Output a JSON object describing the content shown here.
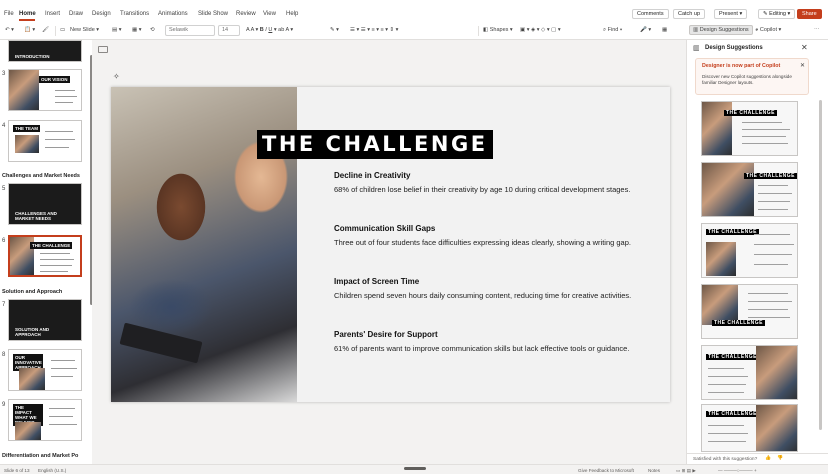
{
  "menubar": {
    "tabs": [
      "File",
      "Home",
      "Insert",
      "Draw",
      "Design",
      "Transitions",
      "Animations",
      "Slide Show",
      "Review",
      "View",
      "Help"
    ],
    "active_tab": "Home",
    "comments": "Comments",
    "catch_up": "Catch up",
    "present": "Present",
    "editing": "Editing",
    "share": "Share"
  },
  "ribbon": {
    "new_slide": "New Slide",
    "font_name": "Selawik",
    "font_size": "14",
    "shapes": "Shapes",
    "find": "Find",
    "design_suggestions": "Design Suggestions",
    "copilot": "Copilot"
  },
  "thumbnails": {
    "sections": [
      "Challenges and Market Needs",
      "Solution and Approach",
      "Differentiation and Market Po"
    ],
    "slides": [
      {
        "num": "",
        "label": "INTRODUCTION"
      },
      {
        "num": "3",
        "label": "OUR VISION"
      },
      {
        "num": "4",
        "label": "THE TEAM"
      },
      {
        "num": "5",
        "label": "CHALLENGES AND MARKET NEEDS"
      },
      {
        "num": "6",
        "label": "THE CHALLENGE"
      },
      {
        "num": "7",
        "label": "SOLUTION AND APPROACH"
      },
      {
        "num": "8",
        "label": "OUR INNOVATIVE APPROACH"
      },
      {
        "num": "9",
        "label": "THE IMPACT WHAT WE DELIVER"
      }
    ]
  },
  "slide": {
    "title": "THE CHALLENGE",
    "items": [
      {
        "heading": "Decline in Creativity",
        "body": "68% of children lose belief in their creativity by age 10 during critical development stages."
      },
      {
        "heading": "Communication Skill Gaps",
        "body": "Three out of four students face difficulties expressing ideas clearly, showing a writing gap."
      },
      {
        "heading": "Impact of Screen Time",
        "body": "Children spend seven hours daily consuming content, reducing time for creative activities."
      },
      {
        "heading": "Parents' Desire for Support",
        "body": "61% of parents want to improve communication skills but lack effective tools or guidance."
      }
    ]
  },
  "design_pane": {
    "title": "Design Suggestions",
    "card_title": "Designer is now part of Copilot",
    "card_body": "Discover new Copilot suggestions alongside familiar Designer layouts.",
    "design_label": "THE CHALLENGE",
    "feedback": "Satisfied with this suggestion?"
  },
  "statusbar": {
    "slide_info": "Slide 6 of 13",
    "language": "English (U.S.)",
    "feedback": "Give Feedback to Microsoft",
    "notes": "Notes"
  }
}
